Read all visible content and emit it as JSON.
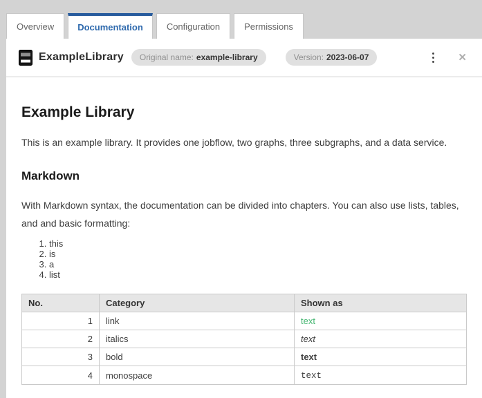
{
  "tabs": [
    {
      "label": "Overview",
      "active": false
    },
    {
      "label": "Documentation",
      "active": true
    },
    {
      "label": "Configuration",
      "active": false
    },
    {
      "label": "Permissions",
      "active": false
    }
  ],
  "header": {
    "title": "ExampleLibrary",
    "original_name_label": "Original name:",
    "original_name_value": "example-library",
    "version_label": "Version:",
    "version_value": "2023-06-07"
  },
  "icons": {
    "library": "library-book-icon",
    "menu": "kebab-menu-icon",
    "close": "close-icon",
    "close_glyph": "✕"
  },
  "doc": {
    "title": "Example Library",
    "intro": "This is an example library. It provides one jobflow, two graphs, three subgraphs, and a data service.",
    "section_title": "Markdown",
    "section_text": "With Markdown syntax, the documentation can be divided into chapters. You can also use lists, tables, and and basic formatting:",
    "list": [
      "this",
      "is",
      "a",
      "list"
    ],
    "table": {
      "headers": [
        "No.",
        "Category",
        "Shown as"
      ],
      "rows": [
        {
          "no": "1",
          "category": "link",
          "shown_as": "text",
          "style": "link"
        },
        {
          "no": "2",
          "category": "italics",
          "shown_as": "text",
          "style": "italic"
        },
        {
          "no": "3",
          "category": "bold",
          "shown_as": "text",
          "style": "bold"
        },
        {
          "no": "4",
          "category": "monospace",
          "shown_as": "text",
          "style": "monospace"
        }
      ]
    }
  },
  "colors": {
    "page_bg": "#d3d3d3",
    "panel_bg": "#ffffff",
    "tab_active_border": "#275b9d",
    "tab_active_text": "#2e69ad",
    "tab_inactive_text": "#666666",
    "tab_border": "#c6c6c6",
    "header_divider": "#ececec",
    "badge_bg": "#e0e0e0",
    "badge_label": "#8f8f8f",
    "heading": "#1a1a1a",
    "text": "#3d3d3d",
    "table_border": "#c9c9c9",
    "table_header_bg": "#e6e6e6",
    "link_green": "#45b671",
    "kebab": "#4a4a4a",
    "close_icon": "#b0b0b0"
  }
}
